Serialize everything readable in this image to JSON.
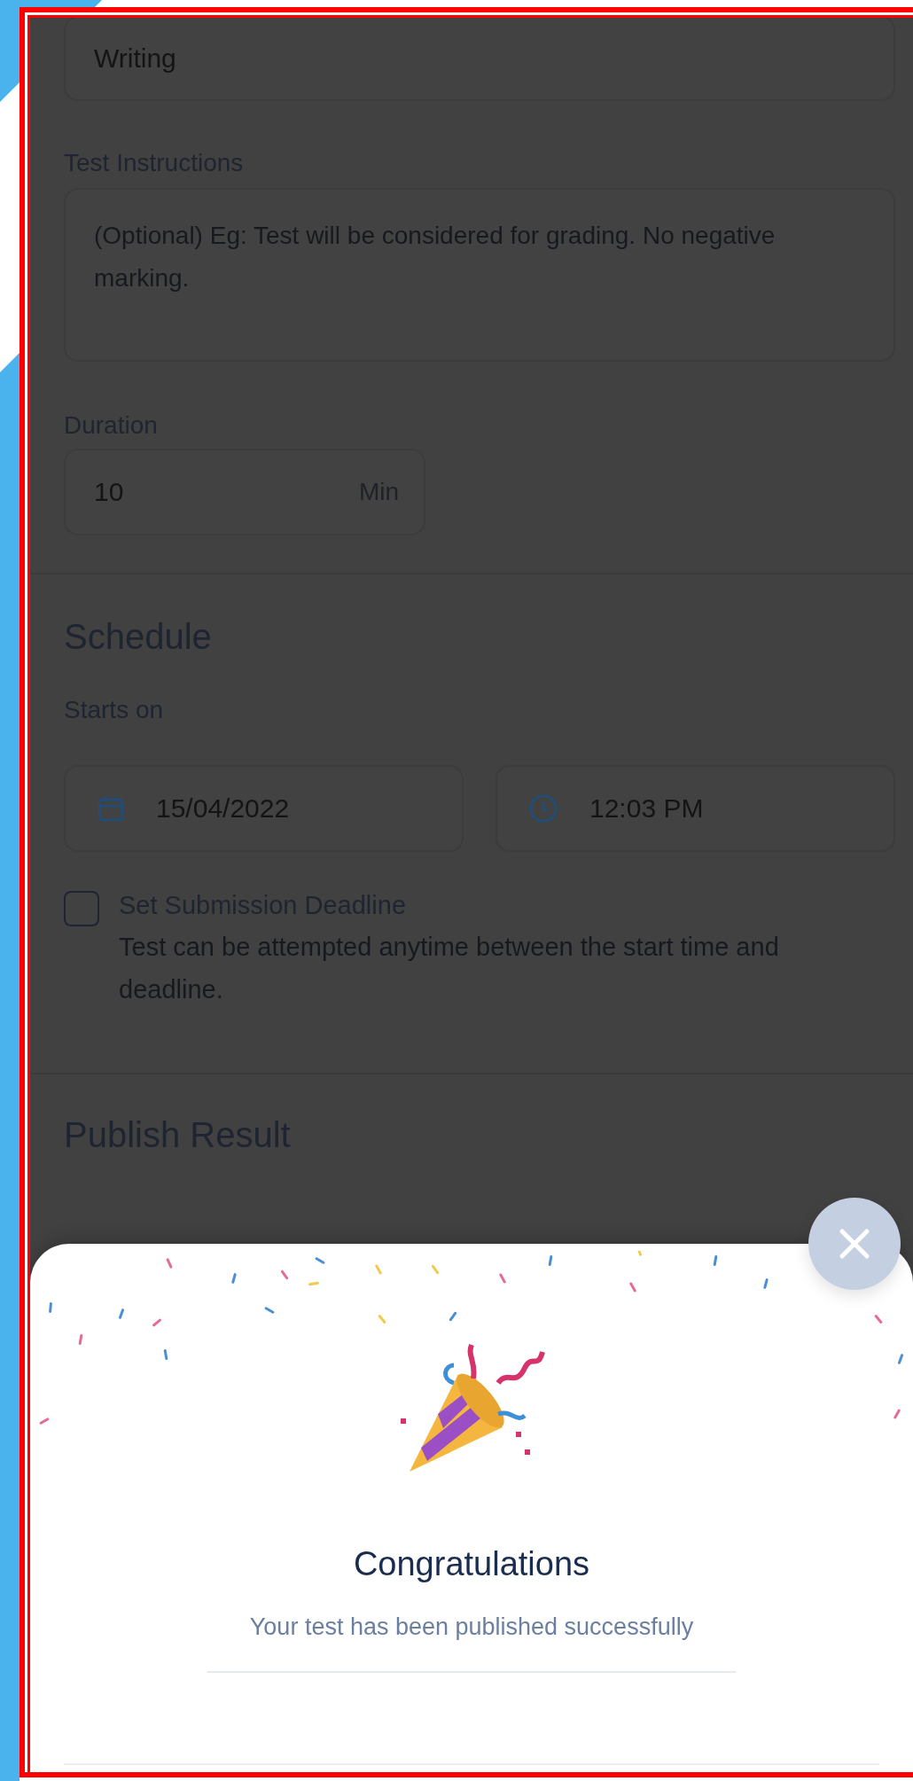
{
  "form": {
    "category_field": {
      "value": "Writing"
    },
    "instructions": {
      "label": "Test Instructions",
      "placeholder": "(Optional) Eg: Test will be considered for grading. No negative marking."
    },
    "duration": {
      "label": "Duration",
      "value": "10",
      "unit": "Min"
    }
  },
  "schedule": {
    "heading": "Schedule",
    "starts_label": "Starts on",
    "date": "15/04/2022",
    "time": "12:03 PM",
    "deadline": {
      "label": "Set Submission Deadline",
      "checked": false,
      "description": "Test can be attempted anytime between the start time and deadline."
    }
  },
  "publish_result": {
    "heading": "Publish Result"
  },
  "success_sheet": {
    "title": "Congratulations",
    "message": "Your test has been published successfully"
  }
}
